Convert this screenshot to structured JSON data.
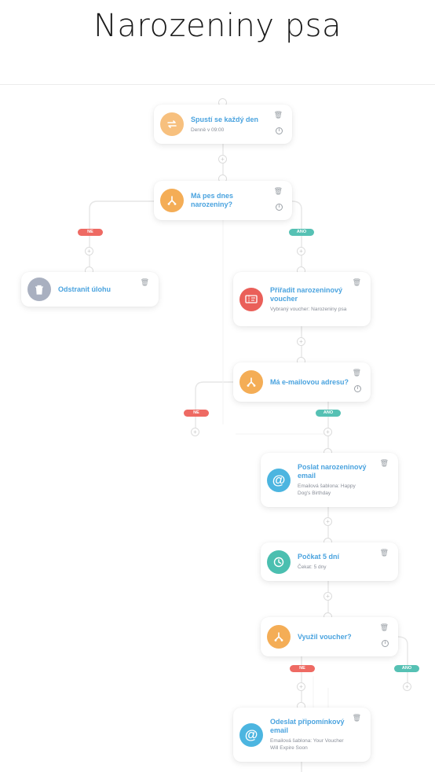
{
  "page": {
    "title": "Narozeniny psa"
  },
  "colors": {
    "orange": "#f4ad56",
    "orange_light": "#f7c07e",
    "gray": "#a9b0c0",
    "red": "#ea5f59",
    "blue": "#4cb5e0",
    "teal": "#4bbfb0",
    "link": "#4aa3df"
  },
  "nodes": {
    "trigger": {
      "name": "Spustí se každý den",
      "sub": "Denně v 09:00",
      "icon": "repeat-icon"
    },
    "cond1": {
      "name": "Má pes dnes narozeniny?",
      "icon": "branch-icon"
    },
    "remove": {
      "name": "Odstranit úlohu",
      "icon": "trash-icon"
    },
    "voucher": {
      "name": "Přiřadit narozeninový voucher",
      "sub": "Vybraný voucher: Narozeniny psa",
      "icon": "ticket-icon"
    },
    "cond2": {
      "name": "Má e-mailovou adresu?",
      "icon": "branch-icon"
    },
    "email1": {
      "name": "Poslat narozeninový email",
      "sub": "Emailová šablona: Happy Dog's Birthday",
      "icon": "at-icon"
    },
    "wait": {
      "name": "Počkat 5 dní",
      "sub": "Čekat: 5 dny",
      "icon": "clock-icon"
    },
    "cond3": {
      "name": "Využil voucher?",
      "icon": "branch-icon"
    },
    "email2": {
      "name": "Odeslat připomínkový email",
      "sub": "Emailová šablona: Your Voucher Will Expire Soon",
      "icon": "at-icon"
    }
  },
  "branches": {
    "no": "NE",
    "yes": "ANO"
  }
}
